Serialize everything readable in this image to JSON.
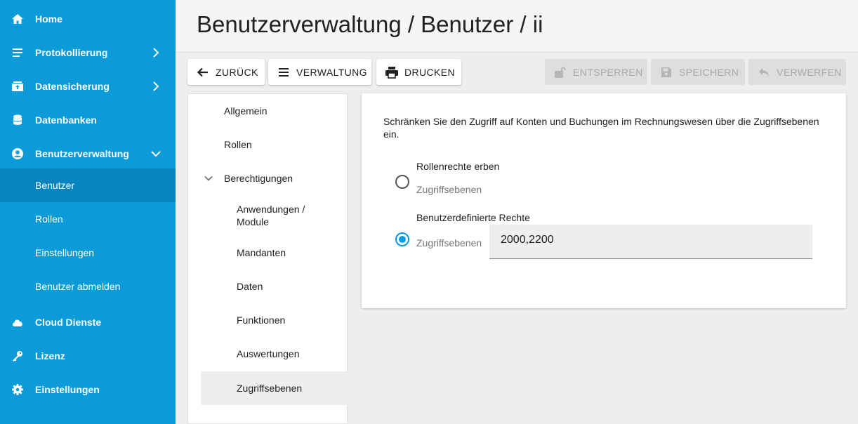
{
  "sidebar": {
    "items": [
      {
        "label": "Home",
        "icon": "home-icon"
      },
      {
        "label": "Protokollierung",
        "icon": "list-icon"
      },
      {
        "label": "Datensicherung",
        "icon": "backup-icon"
      },
      {
        "label": "Datenbanken",
        "icon": "database-icon"
      },
      {
        "label": "Benutzerverwaltung",
        "icon": "user-circle-icon"
      },
      {
        "label": "Cloud Dienste",
        "icon": "cloud-icon"
      },
      {
        "label": "Lizenz",
        "icon": "key-icon"
      },
      {
        "label": "Einstellungen",
        "icon": "gear-icon"
      }
    ],
    "subitems": [
      {
        "label": "Benutzer",
        "active": true
      },
      {
        "label": "Rollen"
      },
      {
        "label": "Einstellungen"
      },
      {
        "label": "Benutzer abmelden"
      }
    ]
  },
  "header": {
    "title": "Benutzerverwaltung / Benutzer / ii"
  },
  "toolbar": {
    "back": "Zurück",
    "admin": "Verwaltung",
    "print": "Drucken",
    "unlock": "Entsperren",
    "save": "Speichern",
    "discard": "Verwerfen"
  },
  "tree": {
    "general": "Allgemein",
    "roles": "Rollen",
    "permissions": "Berechtigungen",
    "apps_line1": "Anwendungen /",
    "apps_line2": "Module",
    "clients": "Mandanten",
    "data": "Daten",
    "functions": "Funktionen",
    "reports": "Auswertungen",
    "access_levels": "Zugriffsebenen"
  },
  "content": {
    "description": "Schränken Sie den Zugriff auf Konten und Buchungen im Rechnungswesen über die Zugriffsebenen ein.",
    "option1_title": "Rollenrechte erben",
    "option1_sub": "Zugriffsebenen",
    "option2_title": "Benutzerdefinierte Rechte",
    "option2_sub": "Zugriffsebenen",
    "access_value": "2000,2200"
  },
  "colors": {
    "accent": "#0a9bd8",
    "sidebar_active": "#0784c0"
  }
}
